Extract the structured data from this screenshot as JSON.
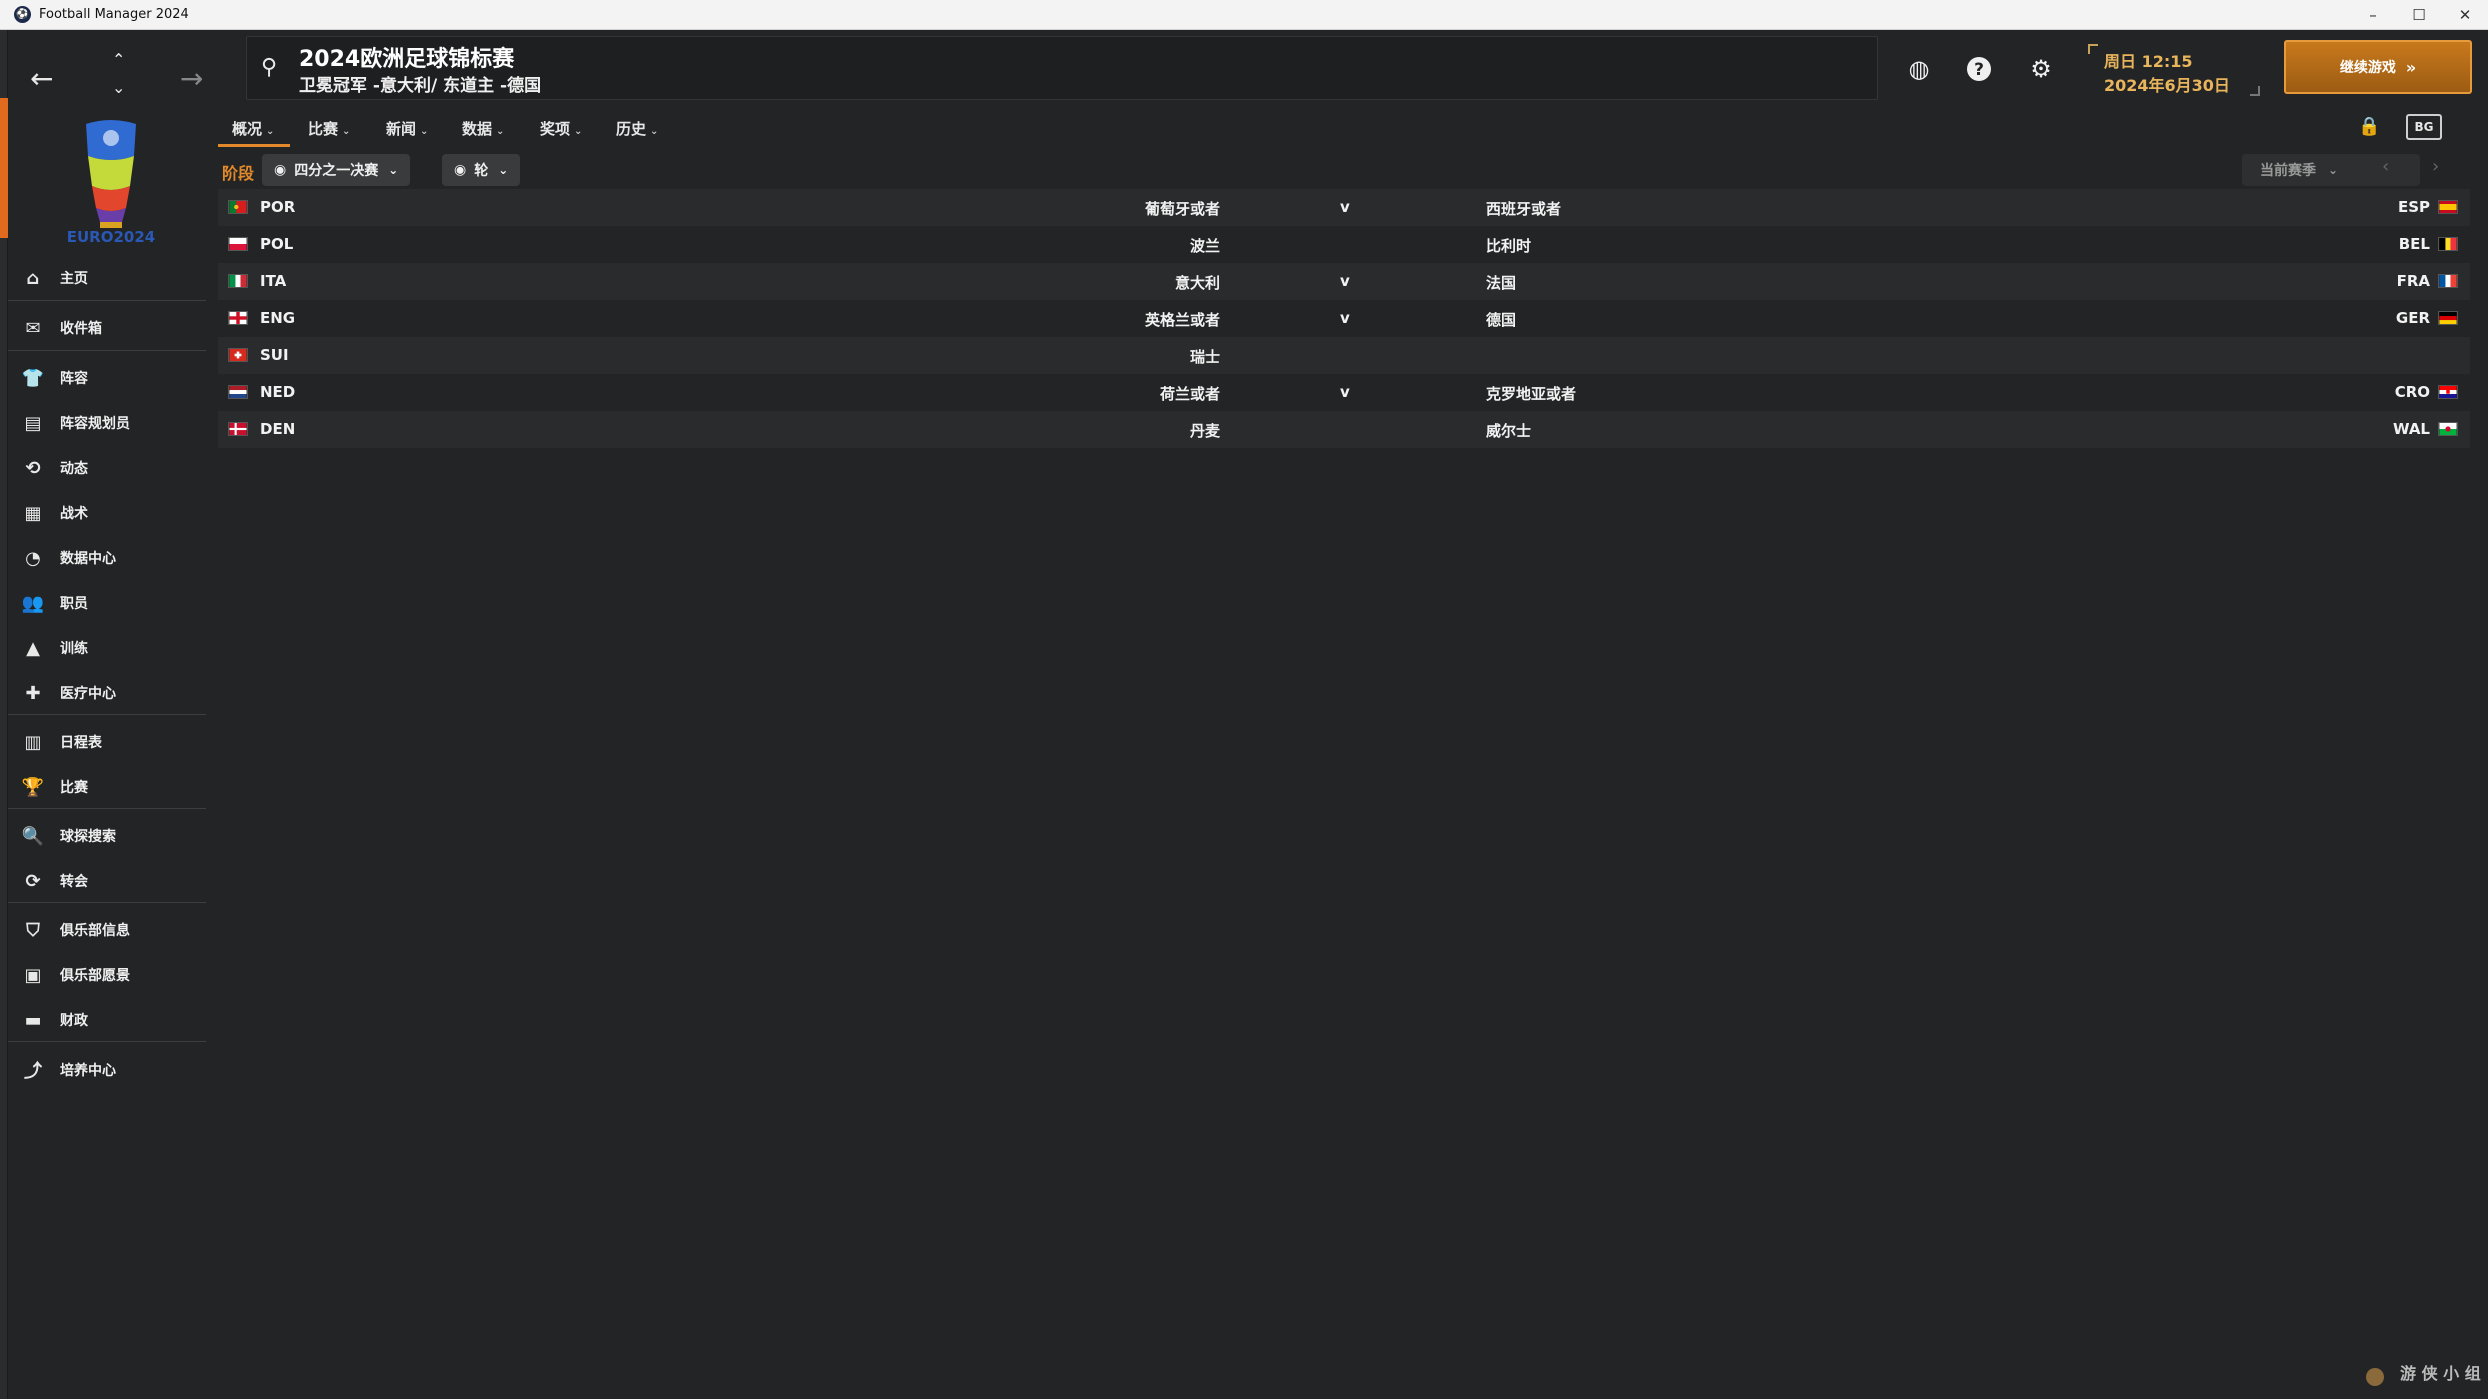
{
  "window": {
    "title": "Football Manager 2024",
    "minimize": "–",
    "maximize": "☐",
    "close": "✕"
  },
  "header": {
    "title": "2024欧洲足球锦标赛",
    "subtitle": "卫冕冠军 -意大利/ 东道主 -德国",
    "date_line1": "周日 12:15",
    "date_line2": "2024年6月30日",
    "continue_label": "继续游戏"
  },
  "nav": {
    "items": [
      {
        "label": "主页",
        "icon": "home-icon"
      },
      {
        "label": "收件箱",
        "icon": "inbox-icon"
      },
      {
        "label": "阵容",
        "icon": "shirt-icon"
      },
      {
        "label": "阵容规划员",
        "icon": "clipboard-icon"
      },
      {
        "label": "动态",
        "icon": "dynamics-icon"
      },
      {
        "label": "战术",
        "icon": "tactics-icon"
      },
      {
        "label": "数据中心",
        "icon": "data-hub-icon"
      },
      {
        "label": "职员",
        "icon": "staff-icon"
      },
      {
        "label": "训练",
        "icon": "training-icon"
      },
      {
        "label": "医疗中心",
        "icon": "medical-icon"
      },
      {
        "label": "日程表",
        "icon": "calendar-icon"
      },
      {
        "label": "比赛",
        "icon": "trophy-icon"
      },
      {
        "label": "球探搜索",
        "icon": "scouting-icon"
      },
      {
        "label": "转会",
        "icon": "transfer-icon"
      },
      {
        "label": "俱乐部信息",
        "icon": "shield-icon"
      },
      {
        "label": "俱乐部愿景",
        "icon": "vision-icon"
      },
      {
        "label": "财政",
        "icon": "finance-icon"
      },
      {
        "label": "培养中心",
        "icon": "development-icon"
      }
    ]
  },
  "tabs": [
    {
      "label": "概况"
    },
    {
      "label": "比赛"
    },
    {
      "label": "新闻"
    },
    {
      "label": "数据"
    },
    {
      "label": "奖项"
    },
    {
      "label": "历史"
    }
  ],
  "filters": {
    "stage_label": "阶段",
    "stage_value": "四分之一决赛",
    "round_value": "轮",
    "season_value": "当前赛季"
  },
  "toolbar": {
    "bg_label": "BG"
  },
  "fixtures": [
    {
      "home_code": "POR",
      "home_name": "葡萄牙或者",
      "vs": "v",
      "away_name": "西班牙或者",
      "away_code": "ESP"
    },
    {
      "home_code": "POL",
      "home_name": "波兰",
      "vs": "",
      "away_name": "比利时",
      "away_code": "BEL"
    },
    {
      "home_code": "ITA",
      "home_name": "意大利",
      "vs": "v",
      "away_name": "法国",
      "away_code": "FRA"
    },
    {
      "home_code": "ENG",
      "home_name": "英格兰或者",
      "vs": "v",
      "away_name": "德国",
      "away_code": "GER"
    },
    {
      "home_code": "SUI",
      "home_name": "瑞士",
      "vs": "",
      "away_name": "",
      "away_code": ""
    },
    {
      "home_code": "NED",
      "home_name": "荷兰或者",
      "vs": "v",
      "away_name": "克罗地亚或者",
      "away_code": "CRO"
    },
    {
      "home_code": "DEN",
      "home_name": "丹麦",
      "vs": "",
      "away_name": "威尔士",
      "away_code": "WAL"
    }
  ],
  "watermark": "游 侠 小 组",
  "colors": {
    "accent": "#e28a2b",
    "date_text": "#e9b55c",
    "background": "#232425",
    "continue_button": "#b36a18"
  }
}
